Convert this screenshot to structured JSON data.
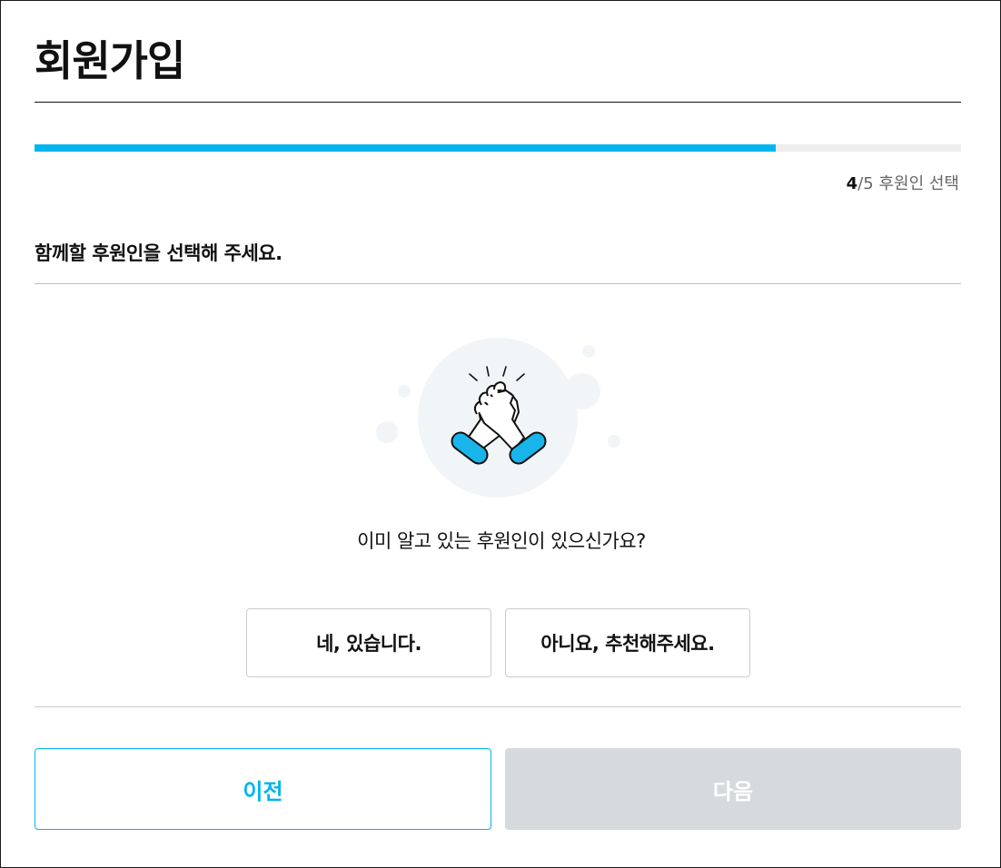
{
  "header": {
    "title": "회원가입"
  },
  "progress": {
    "current_step": "4",
    "total_steps": "/5",
    "step_name": "후원인 선택",
    "fraction": 0.8
  },
  "main": {
    "instruction": "함께할 후원인을 선택해 주세요.",
    "illustration_icon": "handshake-icon",
    "question": "이미 알고 있는 후원인이 있으신가요?",
    "choices": {
      "yes_label": "네, 있습니다.",
      "no_label": "아니요, 추천해주세요."
    }
  },
  "footer": {
    "prev_label": "이전",
    "next_label": "다음"
  },
  "colors": {
    "accent": "#00b4ef",
    "disabled": "#d6dadd",
    "illustration_bg": "#f1f5f8"
  }
}
